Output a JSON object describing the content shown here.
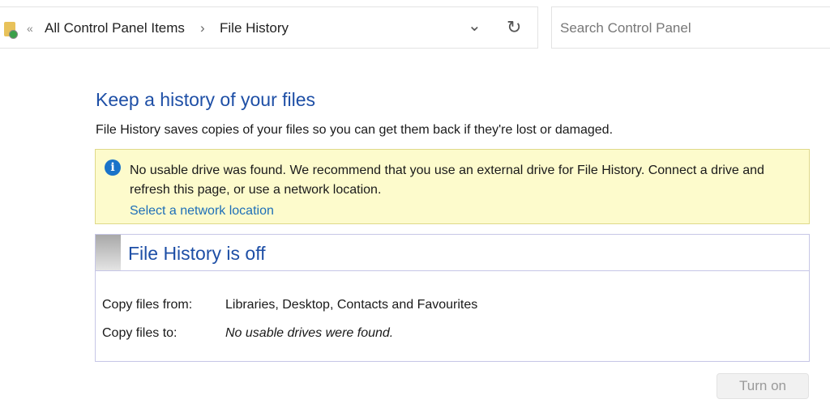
{
  "address": {
    "back_chevrons": "«",
    "crumbs": [
      "All Control Panel Items",
      "File History"
    ],
    "separator": "›",
    "dropdown": "⌄",
    "refresh": "↻"
  },
  "search": {
    "placeholder": "Search Control Panel"
  },
  "main": {
    "title": "Keep a history of your files",
    "description": "File History saves copies of your files so you can get them back if they're lost or damaged.",
    "info": {
      "icon": "i",
      "text": "No usable drive was found. We recommend that you use an external drive for File History. Connect a drive and refresh this page, or use a network location.",
      "link": "Select a network location"
    },
    "panel": {
      "status": "File History is off",
      "rows": [
        {
          "label": "Copy files from:",
          "value": "Libraries, Desktop, Contacts and Favourites"
        },
        {
          "label": "Copy files to:",
          "value": "No usable drives were found."
        }
      ]
    },
    "turn_on": "Turn on"
  }
}
